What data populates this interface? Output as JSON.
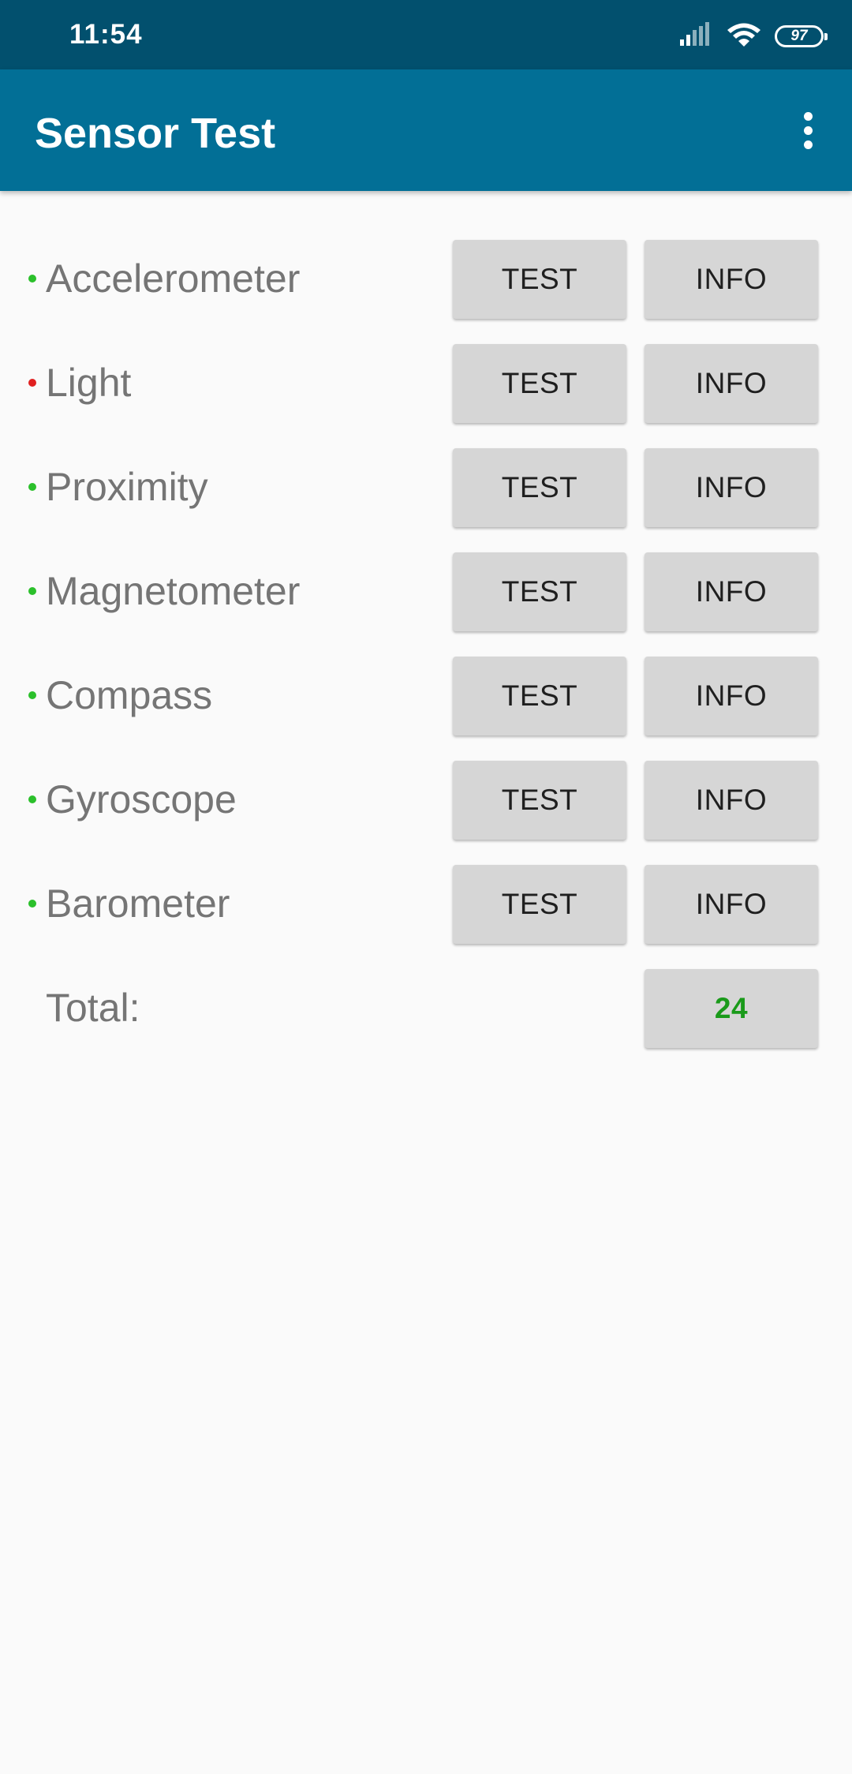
{
  "status_bar": {
    "time": "11:54",
    "battery": "97",
    "icons": [
      "signal-icon",
      "wifi-icon",
      "battery-icon"
    ]
  },
  "app_bar": {
    "title": "Sensor Test",
    "menu_icon": "more-vert-icon"
  },
  "sensors": [
    {
      "name": "Accelerometer",
      "status": "ok",
      "dot_color": "#2bc02b",
      "test_label": "TEST",
      "info_label": "INFO"
    },
    {
      "name": "Light",
      "status": "error",
      "dot_color": "#e02020",
      "test_label": "TEST",
      "info_label": "INFO"
    },
    {
      "name": "Proximity",
      "status": "ok",
      "dot_color": "#2bc02b",
      "test_label": "TEST",
      "info_label": "INFO"
    },
    {
      "name": "Magnetometer",
      "status": "ok",
      "dot_color": "#2bc02b",
      "test_label": "TEST",
      "info_label": "INFO"
    },
    {
      "name": "Compass",
      "status": "ok",
      "dot_color": "#2bc02b",
      "test_label": "TEST",
      "info_label": "INFO"
    },
    {
      "name": "Gyroscope",
      "status": "ok",
      "dot_color": "#2bc02b",
      "test_label": "TEST",
      "info_label": "INFO"
    },
    {
      "name": "Barometer",
      "status": "ok",
      "dot_color": "#2bc02b",
      "test_label": "TEST",
      "info_label": "INFO"
    }
  ],
  "total": {
    "label": "Total:",
    "value": "24",
    "value_color": "#1a9a1a"
  },
  "colors": {
    "status_bar": "#02506e",
    "app_bar": "#026f96",
    "button_bg": "#d6d6d6",
    "background": "#fafafa"
  }
}
